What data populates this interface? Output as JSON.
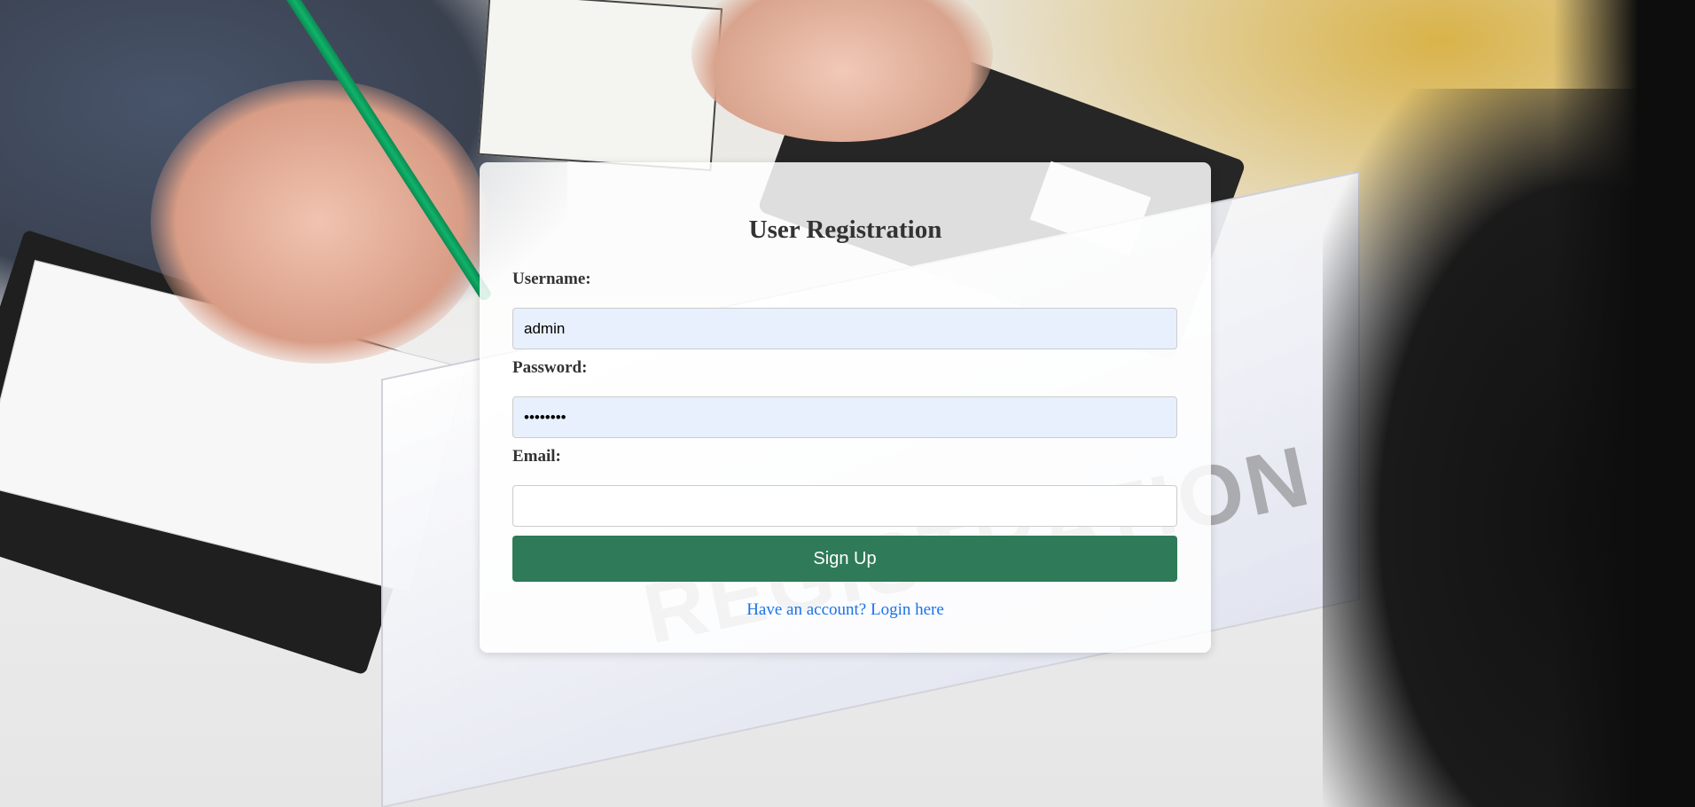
{
  "form": {
    "title": "User Registration",
    "username_label": "Username:",
    "username_value": "admin",
    "password_label": "Password:",
    "password_value": "••••••••",
    "email_label": "Email:",
    "email_value": "",
    "submit_label": "Sign Up",
    "login_link": "Have an account? Login here"
  },
  "background": {
    "sign_text": "REGISTRATION"
  },
  "colors": {
    "button_bg": "#2f7a58",
    "link": "#1a73e8",
    "autofill_bg": "#e8f0fe"
  }
}
